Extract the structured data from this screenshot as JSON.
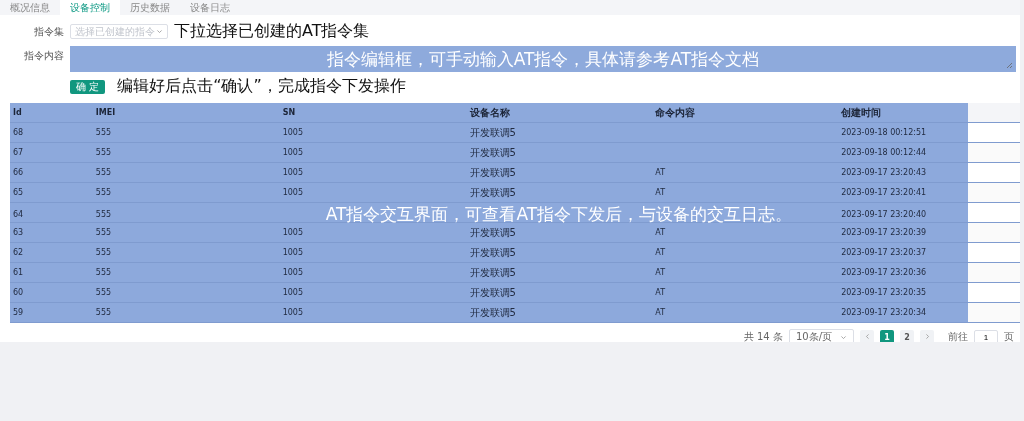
{
  "tabs": [
    {
      "label": "概况信息",
      "selected": false
    },
    {
      "label": "设备控制",
      "selected": true
    },
    {
      "label": "历史数据",
      "selected": false
    },
    {
      "label": "设备日志",
      "selected": false
    }
  ],
  "form": {
    "command_set": {
      "label": "指令集",
      "placeholder": "选择已创建的指令"
    },
    "command_content": {
      "label": "指令内容"
    },
    "confirm_button": "确 定"
  },
  "annotations": {
    "select": "下拉选择已创建的AT指令集",
    "editor": "指令编辑框，可手动输入AT指令，具体请参考AT指令文档",
    "confirm": "编辑好后点击“确认”，完成指令下发操作",
    "table": "AT指令交互界面，可查看AT指令下发后，与设备的交互日志。"
  },
  "table": {
    "columns": [
      "Id",
      "IMEI",
      "SN",
      "设备名称",
      "命令内容",
      "创建时间"
    ],
    "rows": [
      {
        "id": "68",
        "imei": "555",
        "sn": "1005",
        "device": "开发联调5",
        "created": "2023-09-18 00:12:51"
      },
      {
        "id": "67",
        "imei": "555",
        "sn": "1005",
        "device": "开发联调5",
        "created": "2023-09-18 00:12:44"
      },
      {
        "id": "66",
        "imei": "555",
        "sn": "1005",
        "device": "开发联调5",
        "command": "AT",
        "created": "2023-09-17 23:20:43"
      },
      {
        "id": "65",
        "imei": "555",
        "sn": "1005",
        "device": "开发联调5",
        "command": "AT",
        "created": "2023-09-17 23:20:41"
      },
      {
        "id": "64",
        "imei": "555",
        "created": "2023-09-17 23:20:40"
      },
      {
        "id": "63",
        "imei": "555",
        "sn": "1005",
        "device": "开发联调5",
        "command": "AT",
        "created": "2023-09-17 23:20:39"
      },
      {
        "id": "62",
        "imei": "555",
        "sn": "1005",
        "device": "开发联调5",
        "command": "AT",
        "created": "2023-09-17 23:20:37"
      },
      {
        "id": "61",
        "imei": "555",
        "sn": "1005",
        "device": "开发联调5",
        "command": "AT",
        "created": "2023-09-17 23:20:36"
      },
      {
        "id": "60",
        "imei": "555",
        "sn": "1005",
        "device": "开发联调5",
        "command": "AT",
        "created": "2023-09-17 23:20:35"
      },
      {
        "id": "59",
        "imei": "555",
        "sn": "1005",
        "device": "开发联调5",
        "command": "AT",
        "created": "2023-09-17 23:20:34"
      }
    ]
  },
  "pagination": {
    "total": "共 14 条",
    "page_size": "10条/页",
    "pages": [
      {
        "label": "1",
        "selected": true
      },
      {
        "label": "2",
        "selected": false
      }
    ],
    "goto_label": "前往",
    "goto_value": "1",
    "page_unit": "页"
  }
}
